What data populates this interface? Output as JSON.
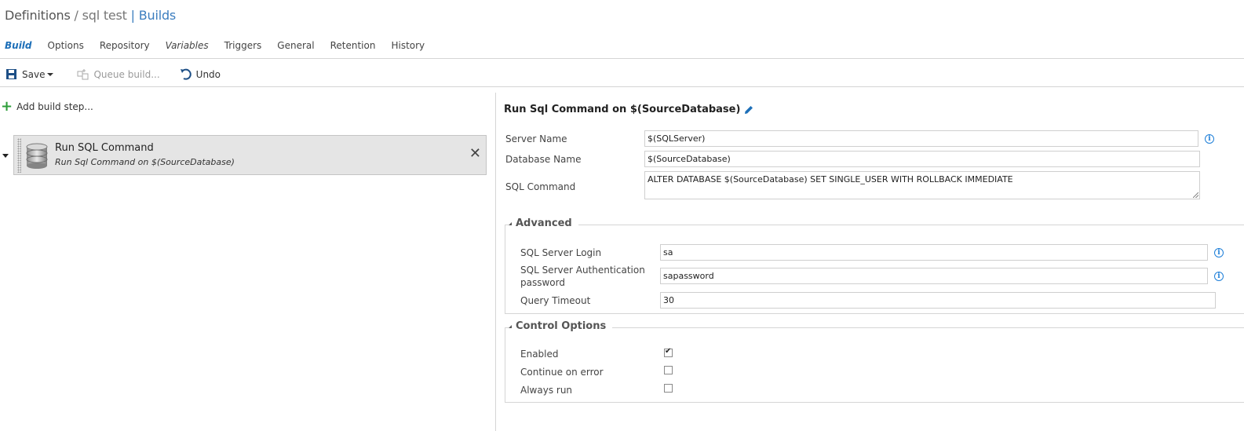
{
  "breadcrumb": {
    "definitions": "Definitions",
    "separator": "/",
    "definition_name": "sql test",
    "pipe": "|",
    "builds_link": "Builds"
  },
  "tabs": [
    {
      "label": "Build",
      "active": true
    },
    {
      "label": "Options"
    },
    {
      "label": "Repository"
    },
    {
      "label": "Variables"
    },
    {
      "label": "Triggers"
    },
    {
      "label": "General"
    },
    {
      "label": "Retention"
    },
    {
      "label": "History"
    }
  ],
  "toolbar": {
    "save_label": "Save",
    "queue_label": "Queue build...",
    "undo_label": "Undo"
  },
  "left": {
    "add_step_label": "Add build step...",
    "step": {
      "title": "Run SQL Command",
      "subtitle": "Run Sql Command on $(SourceDatabase)",
      "close_glyph": "✕"
    }
  },
  "details": {
    "title": "Run Sql Command on $(SourceDatabase)",
    "server_name_label": "Server Name",
    "server_name_value": "$(SQLServer)",
    "database_name_label": "Database Name",
    "database_name_value": "$(SourceDatabase)",
    "sql_command_label": "SQL Command",
    "sql_command_value": "ALTER DATABASE $(SourceDatabase) SET SINGLE_USER WITH ROLLBACK IMMEDIATE",
    "info_glyph": "i"
  },
  "advanced": {
    "heading": "Advanced",
    "login_label": "SQL Server Login",
    "login_value": "sa",
    "password_label_line1": "SQL Server Authentication",
    "password_label_line2": "password",
    "password_value": "sapassword",
    "timeout_label": "Query Timeout",
    "timeout_value": "30"
  },
  "control_options": {
    "heading": "Control Options",
    "enabled_label": "Enabled",
    "enabled_checked": true,
    "continue_label": "Continue on error",
    "continue_checked": false,
    "always_run_label": "Always run",
    "always_run_checked": false
  },
  "colors": {
    "accent": "#1d6fb8",
    "add_green": "#2e9e3a",
    "info_blue": "#1e7fd8"
  }
}
